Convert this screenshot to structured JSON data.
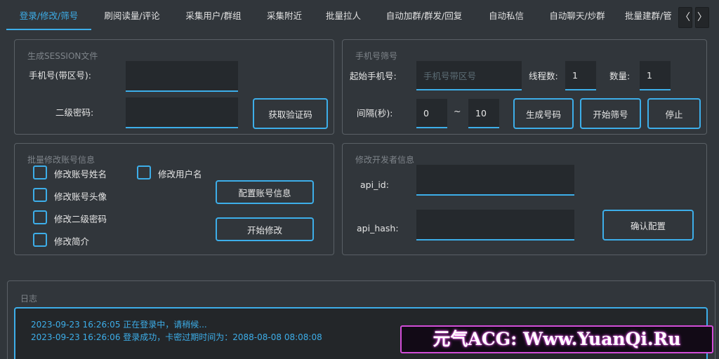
{
  "tabs": [
    {
      "label": "登录/修改/筛号"
    },
    {
      "label": "刷阅读量/评论"
    },
    {
      "label": "采集用户/群组"
    },
    {
      "label": "采集附近"
    },
    {
      "label": "批量拉人"
    },
    {
      "label": "自动加群/群发/回复"
    },
    {
      "label": "自动私信"
    },
    {
      "label": "自动聊天/炒群"
    },
    {
      "label": "批量建群/管"
    }
  ],
  "active_tab": "登录/修改/筛号",
  "scroll_buttons": {
    "left": "〈",
    "right": "〉"
  },
  "session": {
    "title": "生成SESSION文件",
    "phone_label": "手机号(带区号):",
    "phone_value": "",
    "password_label": "二级密码:",
    "password_value": "",
    "get_code_button": "获取验证码"
  },
  "filter": {
    "title": "手机号筛号",
    "start_phone_label": "起始手机号:",
    "start_phone_placeholder": "手机号带区号",
    "threads_label": "线程数:",
    "threads_value": "1",
    "count_label": "数量:",
    "count_value": "1",
    "interval_label": "间隔(秒):",
    "interval_from": "0",
    "interval_sep": "~",
    "interval_to": "10",
    "generate_button": "生成号码",
    "start_button": "开始筛号",
    "stop_button": "停止"
  },
  "batch": {
    "title": "批量修改账号信息",
    "options": [
      {
        "label": "修改账号姓名"
      },
      {
        "label": "修改账号头像"
      },
      {
        "label": "修改二级密码"
      },
      {
        "label": "修改简介"
      },
      {
        "label": "修改用户名"
      }
    ],
    "config_button": "配置账号信息",
    "start_button": "开始修改"
  },
  "developer": {
    "title": "修改开发者信息",
    "api_id_label": "api_id:",
    "api_id_value": "",
    "api_hash_label": "api_hash:",
    "api_hash_value": "",
    "confirm_button": "确认配置"
  },
  "log": {
    "title": "日志",
    "lines": [
      "2023-09-23 16:26:05 正在登录中，请稍候...",
      "2023-09-23 16:26:06 登录成功，卡密过期时间为：2088-08-08 08:08:08"
    ]
  },
  "watermark": "元气ACG: Www.YuanQi.Ru",
  "colors": {
    "accent": "#3daee9",
    "background": "#31363b",
    "watermark_border": "#d24dd8"
  }
}
